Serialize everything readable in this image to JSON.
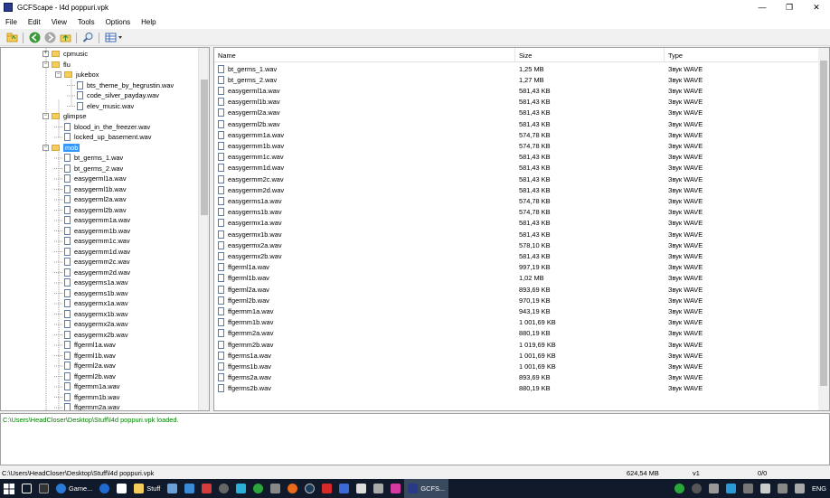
{
  "window": {
    "title": "GCFScape - l4d poppuri.vpk",
    "minimize": "—",
    "restore": "❐",
    "close": "✕"
  },
  "menu": [
    "File",
    "Edit",
    "View",
    "Tools",
    "Options",
    "Help"
  ],
  "toolbar": {
    "icons": [
      "open-icon",
      "back-icon",
      "forward-icon",
      "up-icon",
      "find-icon",
      "view-icon"
    ]
  },
  "tree": {
    "items": [
      {
        "label": "cpmusic",
        "kind": "folder",
        "depth": 0,
        "expander": "+"
      },
      {
        "label": "flu",
        "kind": "folder",
        "depth": 0,
        "expander": "−"
      },
      {
        "label": "jukebox",
        "kind": "folder",
        "depth": 1,
        "expander": "−"
      },
      {
        "label": "bts_theme_by_hegrustin.wav",
        "kind": "file",
        "depth": 2
      },
      {
        "label": "code_silver_payday.wav",
        "kind": "file",
        "depth": 2
      },
      {
        "label": "elev_music.wav",
        "kind": "file",
        "depth": 2
      },
      {
        "label": "glimpse",
        "kind": "folder",
        "depth": 0,
        "expander": "−"
      },
      {
        "label": "blood_in_the_freezer.wav",
        "kind": "file",
        "depth": 1
      },
      {
        "label": "locked_up_basement.wav",
        "kind": "file",
        "depth": 1
      },
      {
        "label": "mob",
        "kind": "folder",
        "depth": 0,
        "expander": "−",
        "selected": true
      },
      {
        "label": "bt_germs_1.wav",
        "kind": "file",
        "depth": 1
      },
      {
        "label": "bt_germs_2.wav",
        "kind": "file",
        "depth": 1
      },
      {
        "label": "easygerml1a.wav",
        "kind": "file",
        "depth": 1
      },
      {
        "label": "easygerml1b.wav",
        "kind": "file",
        "depth": 1
      },
      {
        "label": "easygerml2a.wav",
        "kind": "file",
        "depth": 1
      },
      {
        "label": "easygerml2b.wav",
        "kind": "file",
        "depth": 1
      },
      {
        "label": "easygermm1a.wav",
        "kind": "file",
        "depth": 1
      },
      {
        "label": "easygermm1b.wav",
        "kind": "file",
        "depth": 1
      },
      {
        "label": "easygermm1c.wav",
        "kind": "file",
        "depth": 1
      },
      {
        "label": "easygermm1d.wav",
        "kind": "file",
        "depth": 1
      },
      {
        "label": "easygermm2c.wav",
        "kind": "file",
        "depth": 1
      },
      {
        "label": "easygermm2d.wav",
        "kind": "file",
        "depth": 1
      },
      {
        "label": "easygerms1a.wav",
        "kind": "file",
        "depth": 1
      },
      {
        "label": "easygerms1b.wav",
        "kind": "file",
        "depth": 1
      },
      {
        "label": "easygermx1a.wav",
        "kind": "file",
        "depth": 1
      },
      {
        "label": "easygermx1b.wav",
        "kind": "file",
        "depth": 1
      },
      {
        "label": "easygermx2a.wav",
        "kind": "file",
        "depth": 1
      },
      {
        "label": "easygermx2b.wav",
        "kind": "file",
        "depth": 1
      },
      {
        "label": "ffgerml1a.wav",
        "kind": "file",
        "depth": 1
      },
      {
        "label": "ffgerml1b.wav",
        "kind": "file",
        "depth": 1
      },
      {
        "label": "ffgerml2a.wav",
        "kind": "file",
        "depth": 1
      },
      {
        "label": "ffgerml2b.wav",
        "kind": "file",
        "depth": 1
      },
      {
        "label": "ffgermm1a.wav",
        "kind": "file",
        "depth": 1
      },
      {
        "label": "ffgermm1b.wav",
        "kind": "file",
        "depth": 1
      },
      {
        "label": "ffgermm2a.wav",
        "kind": "file",
        "depth": 1
      }
    ]
  },
  "list": {
    "columns": [
      "Name",
      "Size",
      "Type"
    ],
    "rows": [
      [
        "bt_germs_1.wav",
        "1,25 MB",
        "Звук WAVE"
      ],
      [
        "bt_germs_2.wav",
        "1,27 MB",
        "Звук WAVE"
      ],
      [
        "easygerml1a.wav",
        "581,43 KB",
        "Звук WAVE"
      ],
      [
        "easygerml1b.wav",
        "581,43 KB",
        "Звук WAVE"
      ],
      [
        "easygerml2a.wav",
        "581,43 KB",
        "Звук WAVE"
      ],
      [
        "easygerml2b.wav",
        "581,43 KB",
        "Звук WAVE"
      ],
      [
        "easygermm1a.wav",
        "574,78 KB",
        "Звук WAVE"
      ],
      [
        "easygermm1b.wav",
        "574,78 KB",
        "Звук WAVE"
      ],
      [
        "easygermm1c.wav",
        "581,43 KB",
        "Звук WAVE"
      ],
      [
        "easygermm1d.wav",
        "581,43 KB",
        "Звук WAVE"
      ],
      [
        "easygermm2c.wav",
        "581,43 KB",
        "Звук WAVE"
      ],
      [
        "easygermm2d.wav",
        "581,43 KB",
        "Звук WAVE"
      ],
      [
        "easygerms1a.wav",
        "574,78 KB",
        "Звук WAVE"
      ],
      [
        "easygerms1b.wav",
        "574,78 KB",
        "Звук WAVE"
      ],
      [
        "easygermx1a.wav",
        "581,43 KB",
        "Звук WAVE"
      ],
      [
        "easygermx1b.wav",
        "581,43 KB",
        "Звук WAVE"
      ],
      [
        "easygermx2a.wav",
        "578,10 KB",
        "Звук WAVE"
      ],
      [
        "easygermx2b.wav",
        "581,43 KB",
        "Звук WAVE"
      ],
      [
        "ffgerml1a.wav",
        "997,19 KB",
        "Звук WAVE"
      ],
      [
        "ffgerml1b.wav",
        "1,02 MB",
        "Звук WAVE"
      ],
      [
        "ffgerml2a.wav",
        "893,69 KB",
        "Звук WAVE"
      ],
      [
        "ffgerml2b.wav",
        "970,19 KB",
        "Звук WAVE"
      ],
      [
        "ffgermm1a.wav",
        "943,19 KB",
        "Звук WAVE"
      ],
      [
        "ffgermm1b.wav",
        "1 001,69 KB",
        "Звук WAVE"
      ],
      [
        "ffgermm2a.wav",
        "880,19 KB",
        "Звук WAVE"
      ],
      [
        "ffgermm2b.wav",
        "1 019,69 KB",
        "Звук WAVE"
      ],
      [
        "ffgerms1a.wav",
        "1 001,69 KB",
        "Звук WAVE"
      ],
      [
        "ffgerms1b.wav",
        "1 001,69 KB",
        "Звук WAVE"
      ],
      [
        "ffgerms2a.wav",
        "893,69 KB",
        "Звук WAVE"
      ],
      [
        "ffgerms2b.wav",
        "880,19 KB",
        "Звук WAVE"
      ]
    ]
  },
  "log": {
    "line": "C:\\Users\\HeadCloser\\Desktop\\Stuff\\l4d poppuri.vpk loaded."
  },
  "status": {
    "path": "C:\\Users\\HeadCloser\\Desktop\\Stuff\\l4d poppuri.vpk",
    "size": "624,54 MB",
    "version": "v1",
    "count": "0/0"
  },
  "taskbar": {
    "apps": [
      {
        "label": "Game...",
        "active": false
      },
      {
        "label": "Stuff",
        "active": false
      },
      {
        "label": "GCFS...",
        "active": true
      }
    ],
    "tray": "ENG"
  }
}
